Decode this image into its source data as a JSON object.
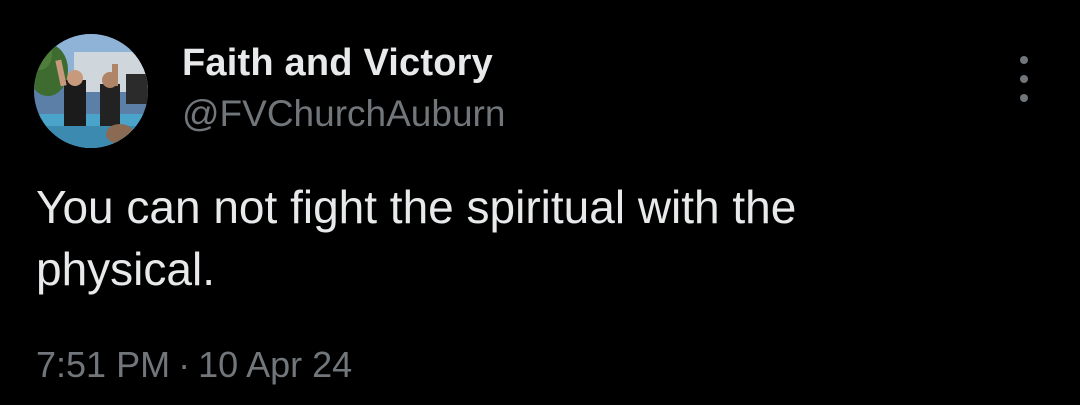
{
  "tweet": {
    "author": {
      "display_name": "Faith and Victory",
      "handle": "@FVChurchAuburn",
      "avatar_icon": "profile-photo"
    },
    "text_line1": "You can not fight the spiritual with the",
    "text_line2": "physical.",
    "time": "7:51 PM",
    "separator": "·",
    "date": "10 Apr 24",
    "more_icon": "more-vertical-icon"
  },
  "colors": {
    "background": "#000000",
    "primary_text": "#e7e9ea",
    "secondary_text": "#71767b"
  }
}
